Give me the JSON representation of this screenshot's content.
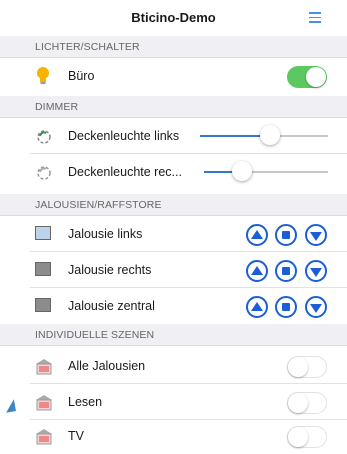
{
  "header": {
    "title": "Bticino-Demo",
    "menu_icon": "hamburger-icon"
  },
  "colors": {
    "accent": "#4a90e2",
    "toggle_on": "#5bc95f",
    "blind_button": "#1c5fd4"
  },
  "sections": {
    "lights": "LICHTER/SCHALTER",
    "dimmer": "DIMMER",
    "blinds": "JALOUSIEN/RAFFSTORE",
    "scenes": "INDIVIDUELLE SZENEN"
  },
  "lights": [
    {
      "label": "Büro",
      "on": true,
      "icon": "lightbulb-icon"
    }
  ],
  "dimmers": [
    {
      "label": "Deckenleuchte links",
      "level_percent": 55,
      "icon": "dimmer-lamp-icon"
    },
    {
      "label": "Deckenleuchte rec...",
      "level_percent": 35,
      "icon": "dimmer-lamp-icon"
    }
  ],
  "blinds": [
    {
      "label": "Jalousie links",
      "state": "open",
      "icon": "blind-open-icon"
    },
    {
      "label": "Jalousie rechts",
      "state": "closed",
      "icon": "blind-closed-icon"
    },
    {
      "label": "Jalousie zentral",
      "state": "closed",
      "icon": "blind-closed-icon"
    }
  ],
  "scenes": [
    {
      "label": "Alle Jalousien",
      "on": false,
      "icon": "scene-building-icon"
    },
    {
      "label": "Lesen",
      "on": false,
      "icon": "scene-building-icon"
    },
    {
      "label": "TV",
      "on": false,
      "icon": "scene-building-icon"
    }
  ]
}
